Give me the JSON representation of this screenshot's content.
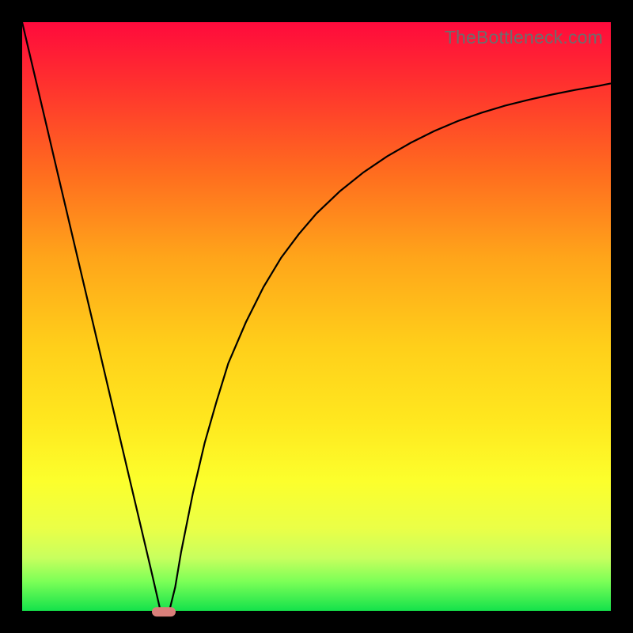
{
  "watermark": "TheBottleneck.com",
  "marker_color": "#d97f7a",
  "chart_data": {
    "type": "line",
    "title": "",
    "xlabel": "",
    "ylabel": "",
    "xlim": [
      0,
      100
    ],
    "ylim": [
      0,
      100
    ],
    "grid": false,
    "legend": false,
    "x": [
      0,
      2,
      4,
      6,
      8,
      10,
      12,
      14,
      16,
      18,
      20,
      22,
      23.5,
      25,
      26,
      27,
      29,
      31,
      33,
      35,
      38,
      41,
      44,
      47,
      50,
      54,
      58,
      62,
      66,
      70,
      74,
      78,
      82,
      86,
      90,
      94,
      98,
      100
    ],
    "y": [
      100,
      91.5,
      83,
      74.5,
      66,
      57.5,
      49,
      40.5,
      32,
      23.5,
      15,
      6.5,
      0,
      0,
      4,
      10,
      20,
      28.5,
      35.5,
      42,
      49,
      55,
      60,
      64,
      67.5,
      71.3,
      74.5,
      77.2,
      79.5,
      81.5,
      83.2,
      84.6,
      85.8,
      86.8,
      87.7,
      88.5,
      89.2,
      89.6
    ],
    "annotation": {
      "x": 24,
      "y": 0,
      "label": "marker"
    }
  }
}
